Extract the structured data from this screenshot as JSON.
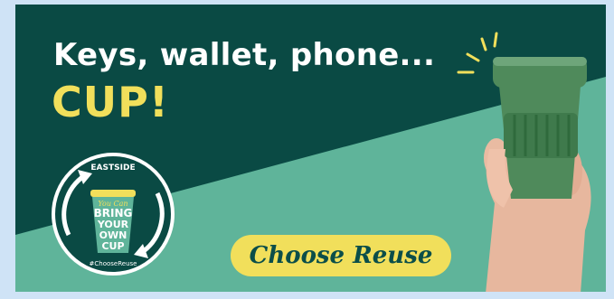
{
  "banner": {
    "headline_line1": "Keys, wallet, phone...",
    "headline_line2": "CUP!",
    "cta_label": "Choose Reuse",
    "colors": {
      "dark_green": "#0a4a44",
      "light_teal": "#5fb49a",
      "yellow": "#f1df5b",
      "page_bg": "#cfe3f6"
    }
  },
  "badge": {
    "top_text": "EASTSIDE",
    "script_text": "You Can",
    "bring": "BRING",
    "your": "YOUR",
    "own": "OWN",
    "cup": "CUP",
    "hashtag": "#ChooseReuse"
  }
}
